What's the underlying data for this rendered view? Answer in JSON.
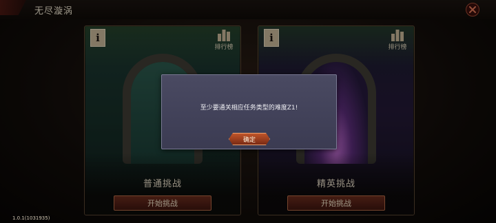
{
  "header": {
    "title": "无尽漩涡",
    "close_icon": "close-icon"
  },
  "cards": [
    {
      "info_icon": "info-icon",
      "rank_label": "排行榜",
      "name": "普通挑战",
      "start_label": "开始挑战"
    },
    {
      "info_icon": "info-icon",
      "rank_label": "排行榜",
      "name": "精英挑战",
      "start_label": "开始挑战"
    }
  ],
  "dialog": {
    "message": "至少要通关相应任务类型的难度Z1!",
    "confirm_label": "确定"
  },
  "footer": {
    "version": "1.0.1(1031935)"
  },
  "colors": {
    "accent": "#b46a47",
    "dialog_bg": "#4a4a62"
  }
}
